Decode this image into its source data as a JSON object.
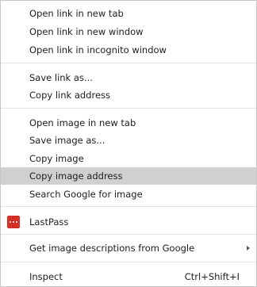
{
  "menu": {
    "items": {
      "open_new_tab": "Open link in new tab",
      "open_new_window": "Open link in new window",
      "open_incognito": "Open link in incognito window",
      "save_link": "Save link as...",
      "copy_link": "Copy link address",
      "open_image_tab": "Open image in new tab",
      "save_image": "Save image as...",
      "copy_image": "Copy image",
      "copy_image_address": "Copy image address",
      "search_google_image": "Search Google for image",
      "lastpass": "LastPass",
      "image_descriptions": "Get image descriptions from Google",
      "inspect": "Inspect"
    },
    "shortcuts": {
      "inspect": "Ctrl+Shift+I"
    },
    "highlighted_item": "Copy image address",
    "colors": {
      "highlight": "#d0d0d0",
      "lastpass_brand": "#d32d27"
    }
  }
}
